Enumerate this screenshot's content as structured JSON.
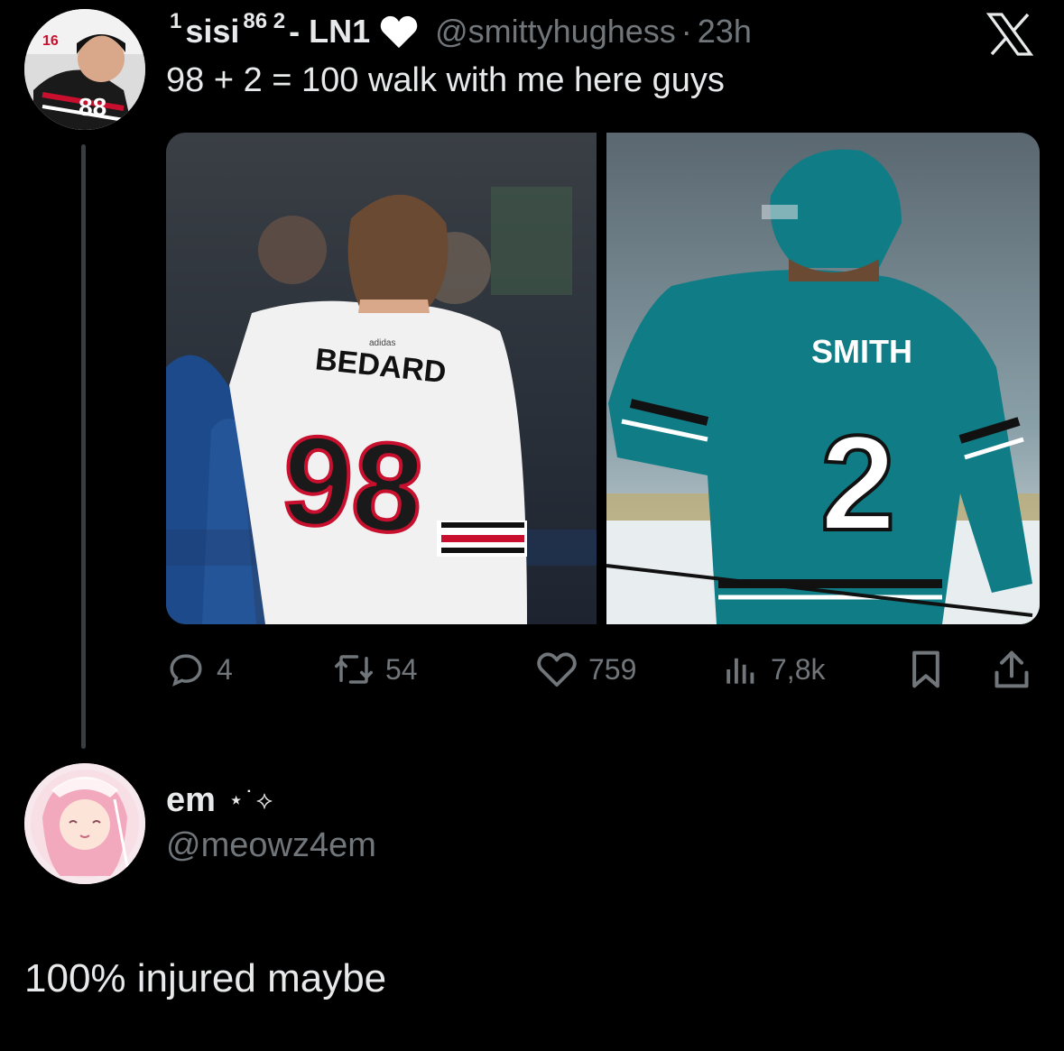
{
  "tweet": {
    "author": {
      "name_pre": "1",
      "name_main": "sisi",
      "name_sup": "86 2",
      "name_suffix": "- LN1",
      "badge_icon": "white-heart-icon",
      "handle": "@smittyhughess",
      "separator": "·",
      "time": "23h"
    },
    "text": "98 + 2 = 100 walk with me here guys",
    "media": {
      "left_player": {
        "name": "BEDARD",
        "number": "98",
        "brand": "adidas"
      },
      "right_player": {
        "name": "SMITH",
        "number": "2"
      }
    },
    "actions": {
      "replies": "4",
      "reposts": "54",
      "likes": "759",
      "views": "7,8k"
    }
  },
  "reply": {
    "name": "em",
    "decoration": "⋆˙⟡",
    "handle": "@meowz4em",
    "text": "100% injured maybe"
  },
  "colors": {
    "background": "#000000",
    "text_primary": "#e7e9ea",
    "text_secondary": "#71767b",
    "thread_line": "#3a3d40",
    "sharks_teal": "#0f7c86",
    "hawks_red": "#c8102e"
  }
}
